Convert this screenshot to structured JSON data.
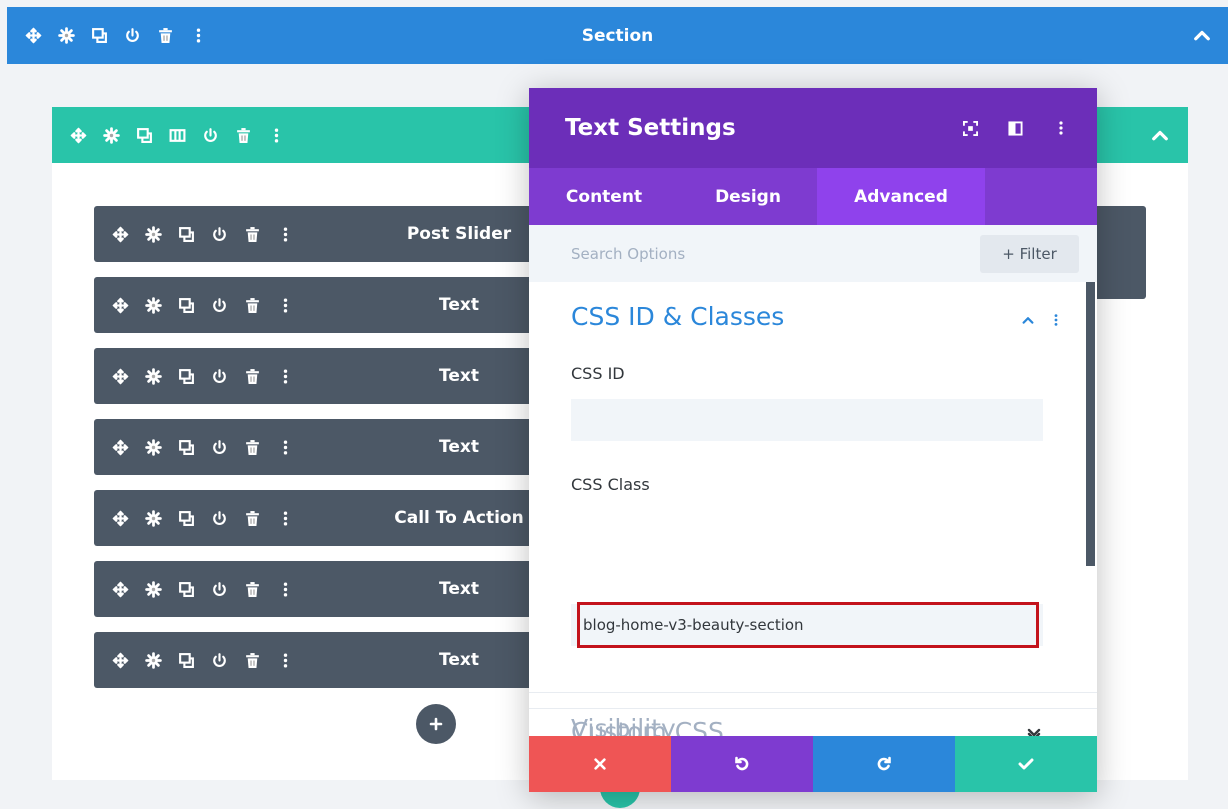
{
  "section": {
    "title": "Section"
  },
  "modules": [
    {
      "label": "Post Slider"
    },
    {
      "label": "Text"
    },
    {
      "label": "Text"
    },
    {
      "label": "Text"
    },
    {
      "label": "Call To Action"
    },
    {
      "label": "Text"
    },
    {
      "label": "Text"
    }
  ],
  "modal": {
    "title": "Text Settings",
    "tabs": {
      "content": "Content",
      "design": "Design",
      "advanced": "Advanced"
    },
    "search": {
      "placeholder": "Search Options",
      "filter_label": "+ Filter"
    },
    "groups": {
      "css": {
        "title": "CSS ID & Classes",
        "css_id_label": "CSS ID",
        "css_id_value": "",
        "css_class_label": "CSS Class",
        "css_class_value": "blog-home-v3-beauty-section"
      },
      "custom_css": {
        "title": "Custom CSS"
      },
      "visibility": {
        "title": "Visibility"
      }
    }
  },
  "colors": {
    "section_blue": "#2b87da",
    "row_teal": "#29c4a9",
    "module_gray": "#4c5866",
    "modal_purple": "#6c2eb9",
    "tab_purple": "#7e3bd0",
    "highlight_red": "#c3131c",
    "cancel_red": "#ef5555"
  },
  "icons": {
    "toolbar": [
      "move-icon",
      "gear-icon",
      "duplicate-icon",
      "power-icon",
      "trash-icon",
      "more-icon"
    ],
    "row_extra": "columns-icon",
    "modal_header": [
      "fullscreen-icon",
      "split-view-icon",
      "more-icon"
    ],
    "footer": [
      "close-icon",
      "undo-icon",
      "redo-icon",
      "check-icon"
    ]
  }
}
